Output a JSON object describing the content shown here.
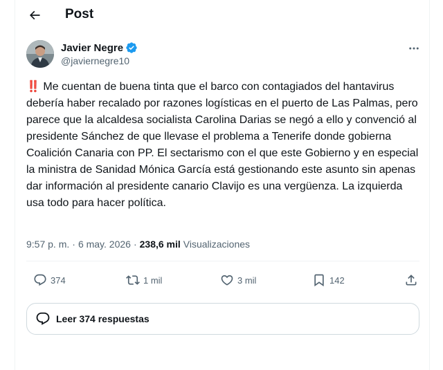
{
  "header": {
    "title": "Post",
    "back_icon": "arrow-left-icon"
  },
  "author": {
    "display_name": "Javier Negre",
    "handle": "@javiernegre10",
    "verified_color": "#1d9bf0"
  },
  "tweet": {
    "emoji": "‼️",
    "text": "Me cuentan de buena tinta que el barco con contagiados del hantavirus debería haber recalado por razones logísticas en el puerto de Las Palmas, pero parece que la alcaldesa socialista Carolina Darias se negó a ello y convenció al presidente Sánchez de que llevase el problema a Tenerife donde gobierna Coalición Canaria con PP. El sectarismo con el que este Gobierno y en especial la ministra de Sanidad Mónica García está gestionando este asunto sin apenas dar información al presidente canario Clavijo es una vergüenza. La izquierda usa todo para hacer política."
  },
  "meta": {
    "time": "9:57 p. m.",
    "separator": "·",
    "date": "6 may. 2026",
    "views_count": "238,6 mil",
    "views_label": "Visualizaciones"
  },
  "actions": {
    "replies": "374",
    "reposts": "1 mil",
    "likes": "3 mil",
    "bookmarks": "142"
  },
  "replies_button": {
    "label": "Leer 374 respuestas"
  },
  "colors": {
    "text": "#0f1419",
    "secondary": "#536471",
    "border": "#cfd9de",
    "accent": "#1d9bf0"
  }
}
